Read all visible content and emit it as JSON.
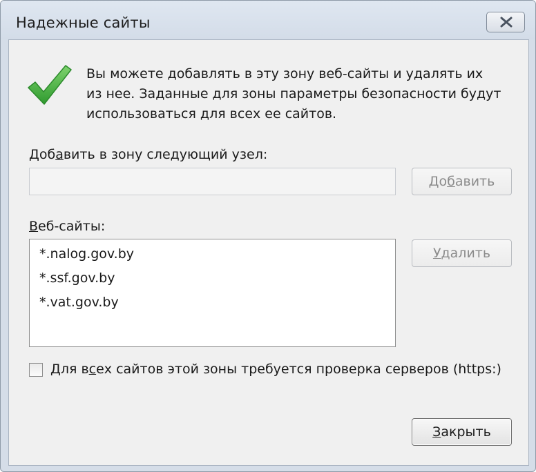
{
  "window": {
    "title": "Надежные сайты"
  },
  "description": {
    "line1": "Вы можете добавлять в эту зону  веб-сайты и удалять их",
    "line2": "из нее. Заданные для зоны параметры безопасности будут",
    "line3": "использоваться для всех ее сайтов."
  },
  "add_zone": {
    "label_pre": "Доб",
    "label_key": "а",
    "label_post": "вить в зону следующий узел:",
    "input_value": "",
    "button_pre": "До",
    "button_key": "б",
    "button_post": "авить"
  },
  "sites": {
    "label_key": "В",
    "label_post": "еб-сайты:",
    "items": [
      "*.nalog.gov.by",
      "*.ssf.gov.by",
      "*.vat.gov.by"
    ],
    "remove_key": "У",
    "remove_post": "далить"
  },
  "https": {
    "checked": false,
    "label_pre": "Для в",
    "label_key": "с",
    "label_post": "ех сайтов этой зоны требуется проверка серверов (https:)"
  },
  "footer": {
    "close_key": "З",
    "close_post": "акрыть"
  },
  "icons": {
    "trusted": "green-checkmark-icon",
    "close": "close-x-icon"
  },
  "colors": {
    "check_green": "#3fae3f",
    "window_frame": "#d5dde8",
    "dialog_bg": "#f0f0f0"
  }
}
